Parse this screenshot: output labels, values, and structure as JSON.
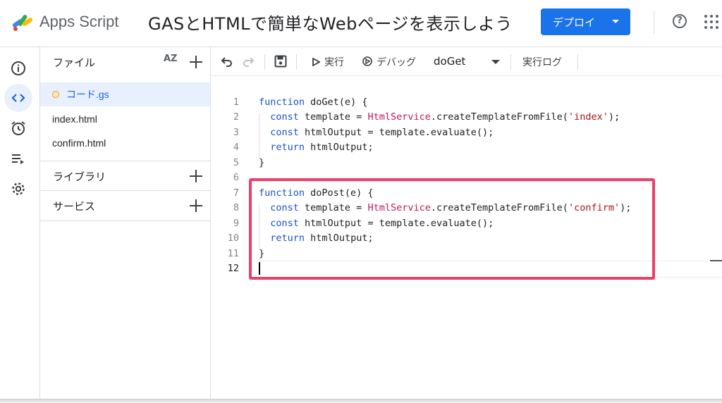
{
  "header": {
    "app_name": "Apps Script",
    "project_title": "GASとHTMLで簡単なWebページを表示しよう",
    "deploy_label": "デプロイ",
    "help_glyph": "?"
  },
  "rail": {
    "items": [
      "overview",
      "editor",
      "triggers",
      "executions",
      "settings"
    ],
    "active": "editor"
  },
  "files_panel": {
    "title": "ファイル",
    "sort_label": "AZ",
    "files": [
      {
        "name": "コード.gs",
        "active": true,
        "unsaved": true
      },
      {
        "name": "index.html",
        "active": false,
        "unsaved": false
      },
      {
        "name": "confirm.html",
        "active": false,
        "unsaved": false
      }
    ],
    "libraries_label": "ライブラリ",
    "services_label": "サービス"
  },
  "toolbar": {
    "run_label": "実行",
    "debug_label": "デバッグ",
    "function_name": "doGet",
    "log_label": "実行ログ"
  },
  "editor": {
    "lines": [
      {
        "n": "1",
        "code": "function doGet(e) {"
      },
      {
        "n": "2",
        "code": "  const template = HtmlService.createTemplateFromFile('index');"
      },
      {
        "n": "3",
        "code": "  const htmlOutput = template.evaluate();"
      },
      {
        "n": "4",
        "code": "  return htmlOutput;"
      },
      {
        "n": "5",
        "code": "}"
      },
      {
        "n": "6",
        "code": ""
      },
      {
        "n": "7",
        "code": "function doPost(e) {"
      },
      {
        "n": "8",
        "code": "  const template = HtmlService.createTemplateFromFile('confirm');"
      },
      {
        "n": "9",
        "code": "  const htmlOutput = template.evaluate();"
      },
      {
        "n": "10",
        "code": "  return htmlOutput;"
      },
      {
        "n": "11",
        "code": "}"
      },
      {
        "n": "12",
        "code": ""
      }
    ],
    "current_line": "12",
    "highlight_color": "#e8406a"
  },
  "colors": {
    "accent": "#1a73e8",
    "keyword": "#1a53c4",
    "string": "#a31515",
    "class": "#c2185b"
  }
}
